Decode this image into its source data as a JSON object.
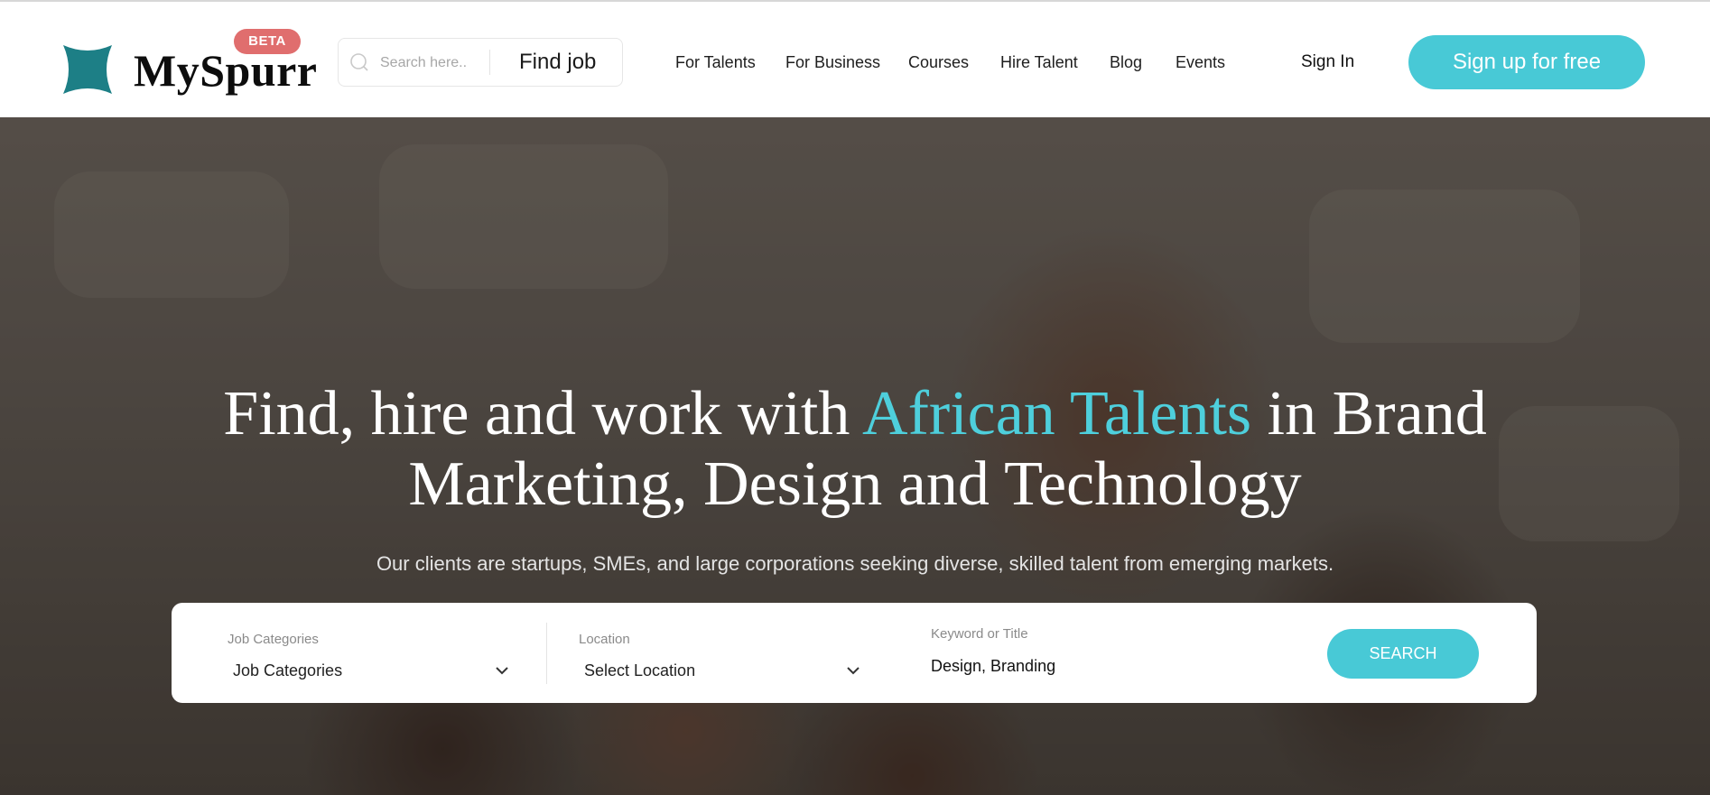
{
  "header": {
    "logo_text": "MySpurr",
    "beta_badge": "BETA",
    "search": {
      "placeholder": "Search here..",
      "find_job_label": "Find job"
    },
    "nav": [
      "For Talents",
      "For Business",
      "Courses",
      "Hire Talent",
      "Blog",
      "Events"
    ],
    "sign_in": "Sign In",
    "sign_up": "Sign up for free"
  },
  "hero": {
    "title_part1": "Find, hire and work with ",
    "title_accent": "African Talents",
    "title_part2": " in Brand Marketing, Design and Technology",
    "subtitle": "Our clients are startups, SMEs, and large corporations seeking diverse, skilled talent from emerging markets."
  },
  "job_search": {
    "category_label": "Job Categories",
    "category_value": "Job Categories",
    "location_label": "Location",
    "location_value": "Select Location",
    "keyword_label": "Keyword or Title",
    "keyword_value": "Design, Branding",
    "search_button": "SEARCH"
  },
  "colors": {
    "accent": "#48c9d6",
    "beta_badge": "#e06e6e",
    "logo_mark": "#1d7f86"
  },
  "icons": [
    "logo-star-icon",
    "search-icon",
    "chevron-down-icon"
  ]
}
